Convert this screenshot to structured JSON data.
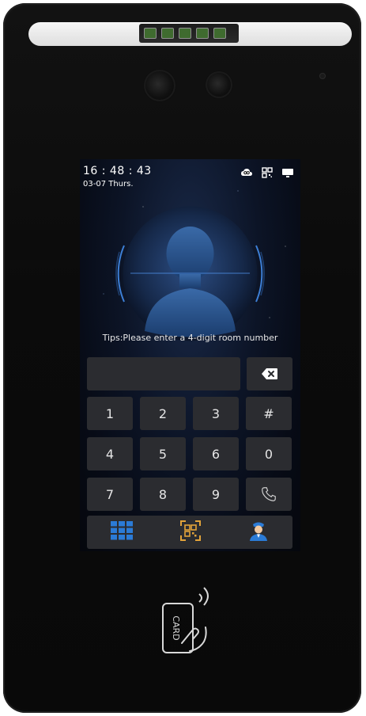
{
  "device": {
    "status_bar": {
      "time": "16 : 48 : 43",
      "date": "03-07 Thurs.",
      "icons": [
        "cloud-link-icon",
        "qr-code-icon",
        "monitor-icon"
      ]
    },
    "face_panel": {
      "tips": "Tips:Please enter a 4-digit room number"
    },
    "keypad": {
      "keys": [
        "1",
        "2",
        "3",
        "#",
        "4",
        "5",
        "6",
        "0",
        "7",
        "8",
        "9"
      ],
      "call_icon": "phone-icon",
      "backspace_icon": "backspace-icon"
    },
    "bottom_bar": {
      "items": [
        "keypad-icon",
        "qr-scan-icon",
        "security-guard-icon"
      ]
    },
    "card_reader": {
      "label": "CARD",
      "icon": "nfc-card-icon"
    },
    "colors": {
      "accent_blue": "#2b7bd6",
      "key_bg": "#2b2c30",
      "qr_orange": "#e2a33a"
    }
  }
}
